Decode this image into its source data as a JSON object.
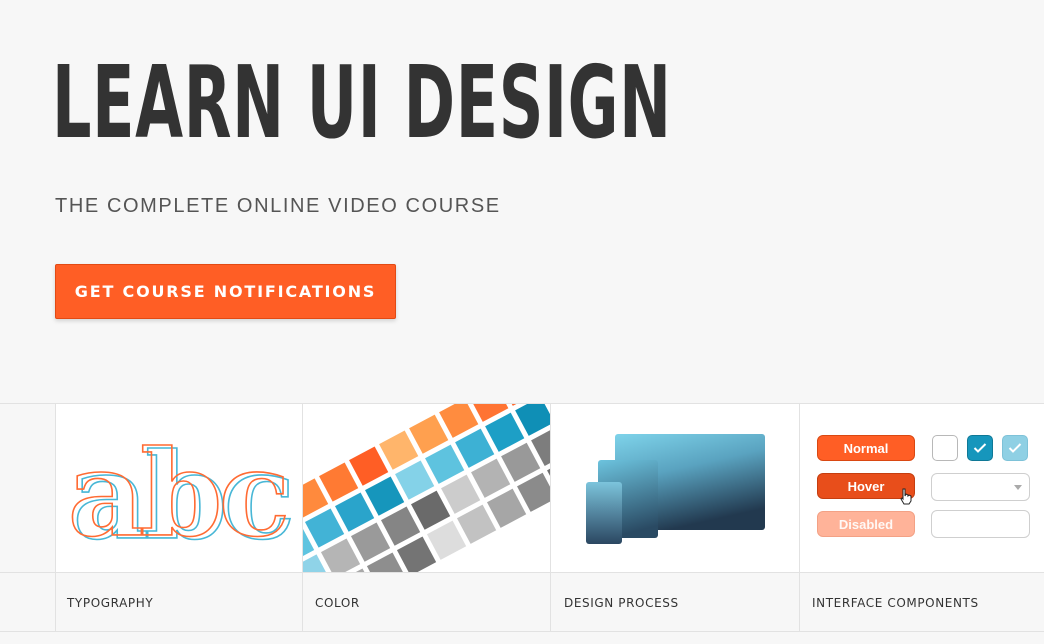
{
  "hero": {
    "title": "LEARN UI DESIGN",
    "subtitle": "THE COMPLETE ONLINE VIDEO COURSE",
    "cta_label": "GET COURSE NOTIFICATIONS"
  },
  "modules": [
    {
      "label": "TYPOGRAPHY",
      "illustration_text": "abc"
    },
    {
      "label": "COLOR"
    },
    {
      "label": "DESIGN PROCESS"
    },
    {
      "label": "INTERFACE COMPONENTS",
      "buttons": {
        "normal": "Normal",
        "hover": "Hover",
        "disabled": "Disabled"
      }
    }
  ],
  "colors": {
    "accent": "#ff5e25",
    "text": "#333333",
    "teal": "#1696bc",
    "background": "#f7f7f7"
  }
}
